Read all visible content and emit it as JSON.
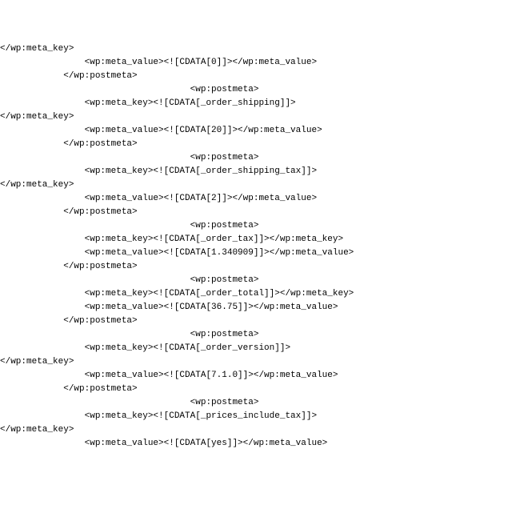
{
  "lines": [
    "</wp:meta_key>",
    "                <wp:meta_value><![CDATA[0]]></wp:meta_value>",
    "            </wp:postmeta>",
    "                                    <wp:postmeta>",
    "                <wp:meta_key><![CDATA[_order_shipping]]>",
    "</wp:meta_key>",
    "                <wp:meta_value><![CDATA[20]]></wp:meta_value>",
    "            </wp:postmeta>",
    "                                    <wp:postmeta>",
    "                <wp:meta_key><![CDATA[_order_shipping_tax]]>",
    "</wp:meta_key>",
    "                <wp:meta_value><![CDATA[2]]></wp:meta_value>",
    "            </wp:postmeta>",
    "                                    <wp:postmeta>",
    "                <wp:meta_key><![CDATA[_order_tax]]></wp:meta_key>",
    "                <wp:meta_value><![CDATA[1.340909]]></wp:meta_value>",
    "            </wp:postmeta>",
    "                                    <wp:postmeta>",
    "                <wp:meta_key><![CDATA[_order_total]]></wp:meta_key>",
    "                <wp:meta_value><![CDATA[36.75]]></wp:meta_value>",
    "            </wp:postmeta>",
    "                                    <wp:postmeta>",
    "                <wp:meta_key><![CDATA[_order_version]]>",
    "</wp:meta_key>",
    "                <wp:meta_value><![CDATA[7.1.0]]></wp:meta_value>",
    "            </wp:postmeta>",
    "                                    <wp:postmeta>",
    "                <wp:meta_key><![CDATA[_prices_include_tax]]>",
    "</wp:meta_key>",
    "                <wp:meta_value><![CDATA[yes]]></wp:meta_value>"
  ]
}
